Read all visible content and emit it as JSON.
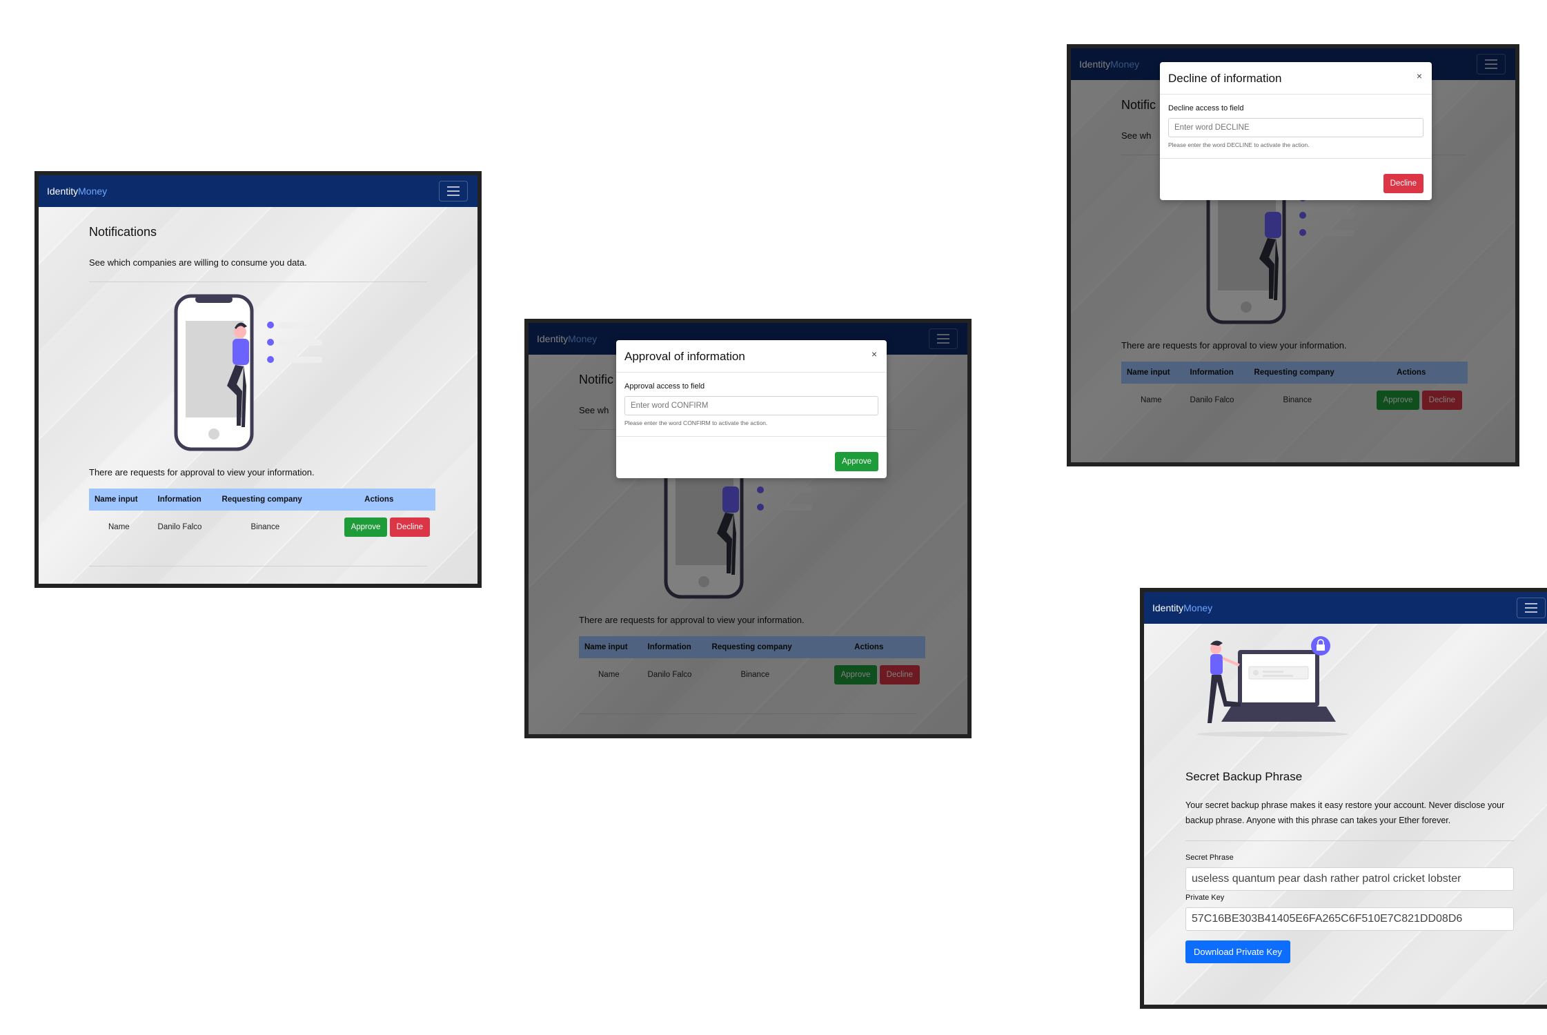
{
  "brand": {
    "part1": "Identity",
    "part2": "Money"
  },
  "notifications": {
    "title": "Notifications",
    "subtitle": "See which companies are willing to consume you data.",
    "subtitle_cut": "See wh",
    "title_cut": "Notific",
    "requests_text": "There are requests for approval to view your information.",
    "table": {
      "headers": [
        "Name input",
        "Information",
        "Requesting company",
        "Actions"
      ],
      "row": {
        "name": "Name",
        "information": "Danilo Falco",
        "company": "Binance"
      },
      "approve_label": "Approve",
      "decline_label": "Decline"
    }
  },
  "approve_modal": {
    "title": "Approval of information",
    "close": "×",
    "label": "Approval access to field",
    "placeholder": "Enter word CONFIRM",
    "help": "Please enter the word CONFIRM to activate the action.",
    "button": "Approve"
  },
  "decline_modal": {
    "title": "Decline of information",
    "close": "×",
    "label": "Decline access to field",
    "placeholder": "Enter word DECLINE",
    "help": "Please enter the word DECLINE to activate the action.",
    "button": "Decline"
  },
  "backup": {
    "title": "Secret Backup Phrase",
    "description": "Your secret backup phrase makes it easy restore your account. Never disclose your backup phrase. Anyone with this phrase can takes your Ether forever.",
    "phrase_label": "Secret Phrase",
    "phrase_value": "useless quantum pear dash rather patrol cricket lobster",
    "key_label": "Private Key",
    "key_value": "57C16BE303B41405E6FA265C6F510E7C821DD08D6",
    "download_button": "Download Private Key"
  },
  "colors": {
    "navbar": "#0c2b6b",
    "brand_accent": "#6ea8fe",
    "approve": "#1f9c3a",
    "decline": "#dc3545",
    "primary": "#0d6efd",
    "table_header": "#9ec5fe",
    "illustration_purple": "#6c63ff"
  }
}
